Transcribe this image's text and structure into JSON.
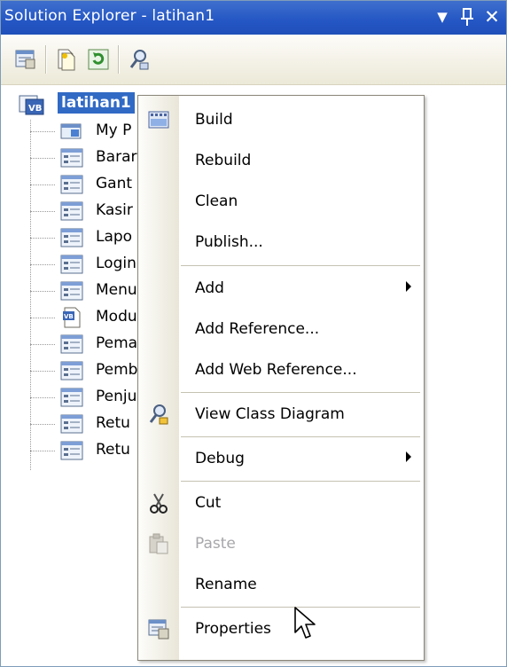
{
  "window": {
    "title": "Solution Explorer - latihan1",
    "controls": [
      {
        "icon": "dropdown-arrow-icon",
        "glyph": "▼"
      },
      {
        "icon": "pin-icon",
        "glyph": "ᚹ"
      },
      {
        "icon": "close-icon",
        "glyph": "✕"
      }
    ]
  },
  "toolbar": {
    "buttons": [
      {
        "icon": "properties-icon"
      },
      {
        "icon": "show-all-files-icon"
      },
      {
        "icon": "refresh-icon"
      },
      {
        "icon": "view-class-diagram-icon"
      }
    ]
  },
  "tree": {
    "root": {
      "label": "latihan1",
      "icon": "vb-project-icon"
    },
    "items": [
      {
        "label": "My P",
        "icon": "my-project-icon"
      },
      {
        "label": "Barar",
        "icon": "form-icon"
      },
      {
        "label": "Gant",
        "icon": "form-icon"
      },
      {
        "label": "Kasir",
        "icon": "form-icon"
      },
      {
        "label": "Lapo",
        "icon": "form-icon"
      },
      {
        "label": "Login",
        "icon": "form-icon"
      },
      {
        "label": "Menu",
        "icon": "form-icon"
      },
      {
        "label": "Modu",
        "icon": "vb-module-icon"
      },
      {
        "label": "Pema",
        "icon": "form-icon"
      },
      {
        "label": "Pemb",
        "icon": "form-icon"
      },
      {
        "label": "Penju",
        "icon": "form-icon"
      },
      {
        "label": "Retu",
        "icon": "form-icon"
      },
      {
        "label": "Retu",
        "icon": "form-icon"
      }
    ]
  },
  "context_menu": {
    "items": [
      {
        "label": "Build",
        "icon": "build-icon"
      },
      {
        "label": "Rebuild"
      },
      {
        "label": "Clean"
      },
      {
        "label": "Publish..."
      },
      {
        "label": "Add",
        "submenu": true
      },
      {
        "label": "Add Reference..."
      },
      {
        "label": "Add Web Reference..."
      },
      {
        "label": "View Class Diagram",
        "icon": "class-diagram-icon"
      },
      {
        "label": "Debug",
        "submenu": true
      },
      {
        "label": "Cut",
        "icon": "scissors-icon"
      },
      {
        "label": "Paste",
        "icon": "paste-icon",
        "disabled": true
      },
      {
        "label": "Rename"
      },
      {
        "label": "Properties",
        "icon": "properties-icon"
      }
    ]
  },
  "colors": {
    "title_bar": "#2456c4",
    "selection": "#316ac5",
    "menu_border": "#8a867a",
    "disabled_text": "#a7a6aa"
  }
}
